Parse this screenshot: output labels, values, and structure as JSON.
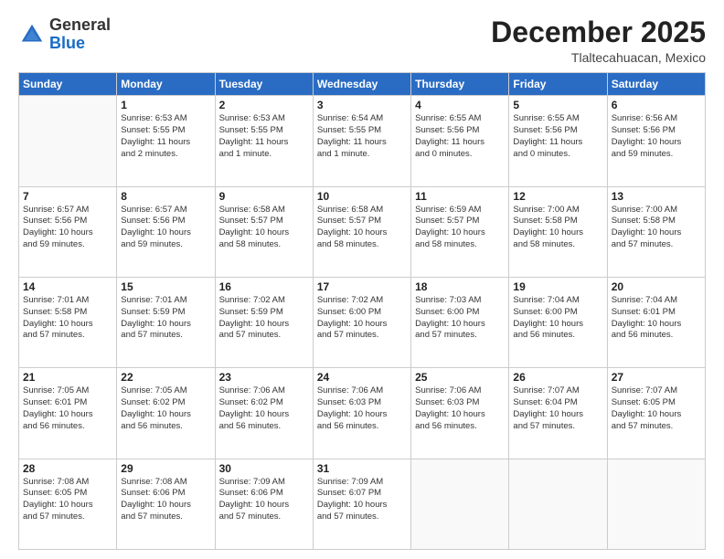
{
  "logo": {
    "line1": "General",
    "line2": "Blue"
  },
  "header": {
    "month_year": "December 2025",
    "location": "Tlaltecahuacan, Mexico"
  },
  "weekdays": [
    "Sunday",
    "Monday",
    "Tuesday",
    "Wednesday",
    "Thursday",
    "Friday",
    "Saturday"
  ],
  "weeks": [
    [
      {
        "day": "",
        "info": ""
      },
      {
        "day": "1",
        "info": "Sunrise: 6:53 AM\nSunset: 5:55 PM\nDaylight: 11 hours\nand 2 minutes."
      },
      {
        "day": "2",
        "info": "Sunrise: 6:53 AM\nSunset: 5:55 PM\nDaylight: 11 hours\nand 1 minute."
      },
      {
        "day": "3",
        "info": "Sunrise: 6:54 AM\nSunset: 5:55 PM\nDaylight: 11 hours\nand 1 minute."
      },
      {
        "day": "4",
        "info": "Sunrise: 6:55 AM\nSunset: 5:56 PM\nDaylight: 11 hours\nand 0 minutes."
      },
      {
        "day": "5",
        "info": "Sunrise: 6:55 AM\nSunset: 5:56 PM\nDaylight: 11 hours\nand 0 minutes."
      },
      {
        "day": "6",
        "info": "Sunrise: 6:56 AM\nSunset: 5:56 PM\nDaylight: 10 hours\nand 59 minutes."
      }
    ],
    [
      {
        "day": "7",
        "info": "Sunrise: 6:57 AM\nSunset: 5:56 PM\nDaylight: 10 hours\nand 59 minutes."
      },
      {
        "day": "8",
        "info": "Sunrise: 6:57 AM\nSunset: 5:56 PM\nDaylight: 10 hours\nand 59 minutes."
      },
      {
        "day": "9",
        "info": "Sunrise: 6:58 AM\nSunset: 5:57 PM\nDaylight: 10 hours\nand 58 minutes."
      },
      {
        "day": "10",
        "info": "Sunrise: 6:58 AM\nSunset: 5:57 PM\nDaylight: 10 hours\nand 58 minutes."
      },
      {
        "day": "11",
        "info": "Sunrise: 6:59 AM\nSunset: 5:57 PM\nDaylight: 10 hours\nand 58 minutes."
      },
      {
        "day": "12",
        "info": "Sunrise: 7:00 AM\nSunset: 5:58 PM\nDaylight: 10 hours\nand 58 minutes."
      },
      {
        "day": "13",
        "info": "Sunrise: 7:00 AM\nSunset: 5:58 PM\nDaylight: 10 hours\nand 57 minutes."
      }
    ],
    [
      {
        "day": "14",
        "info": "Sunrise: 7:01 AM\nSunset: 5:58 PM\nDaylight: 10 hours\nand 57 minutes."
      },
      {
        "day": "15",
        "info": "Sunrise: 7:01 AM\nSunset: 5:59 PM\nDaylight: 10 hours\nand 57 minutes."
      },
      {
        "day": "16",
        "info": "Sunrise: 7:02 AM\nSunset: 5:59 PM\nDaylight: 10 hours\nand 57 minutes."
      },
      {
        "day": "17",
        "info": "Sunrise: 7:02 AM\nSunset: 6:00 PM\nDaylight: 10 hours\nand 57 minutes."
      },
      {
        "day": "18",
        "info": "Sunrise: 7:03 AM\nSunset: 6:00 PM\nDaylight: 10 hours\nand 57 minutes."
      },
      {
        "day": "19",
        "info": "Sunrise: 7:04 AM\nSunset: 6:00 PM\nDaylight: 10 hours\nand 56 minutes."
      },
      {
        "day": "20",
        "info": "Sunrise: 7:04 AM\nSunset: 6:01 PM\nDaylight: 10 hours\nand 56 minutes."
      }
    ],
    [
      {
        "day": "21",
        "info": "Sunrise: 7:05 AM\nSunset: 6:01 PM\nDaylight: 10 hours\nand 56 minutes."
      },
      {
        "day": "22",
        "info": "Sunrise: 7:05 AM\nSunset: 6:02 PM\nDaylight: 10 hours\nand 56 minutes."
      },
      {
        "day": "23",
        "info": "Sunrise: 7:06 AM\nSunset: 6:02 PM\nDaylight: 10 hours\nand 56 minutes."
      },
      {
        "day": "24",
        "info": "Sunrise: 7:06 AM\nSunset: 6:03 PM\nDaylight: 10 hours\nand 56 minutes."
      },
      {
        "day": "25",
        "info": "Sunrise: 7:06 AM\nSunset: 6:03 PM\nDaylight: 10 hours\nand 56 minutes."
      },
      {
        "day": "26",
        "info": "Sunrise: 7:07 AM\nSunset: 6:04 PM\nDaylight: 10 hours\nand 57 minutes."
      },
      {
        "day": "27",
        "info": "Sunrise: 7:07 AM\nSunset: 6:05 PM\nDaylight: 10 hours\nand 57 minutes."
      }
    ],
    [
      {
        "day": "28",
        "info": "Sunrise: 7:08 AM\nSunset: 6:05 PM\nDaylight: 10 hours\nand 57 minutes."
      },
      {
        "day": "29",
        "info": "Sunrise: 7:08 AM\nSunset: 6:06 PM\nDaylight: 10 hours\nand 57 minutes."
      },
      {
        "day": "30",
        "info": "Sunrise: 7:09 AM\nSunset: 6:06 PM\nDaylight: 10 hours\nand 57 minutes."
      },
      {
        "day": "31",
        "info": "Sunrise: 7:09 AM\nSunset: 6:07 PM\nDaylight: 10 hours\nand 57 minutes."
      },
      {
        "day": "",
        "info": ""
      },
      {
        "day": "",
        "info": ""
      },
      {
        "day": "",
        "info": ""
      }
    ]
  ]
}
